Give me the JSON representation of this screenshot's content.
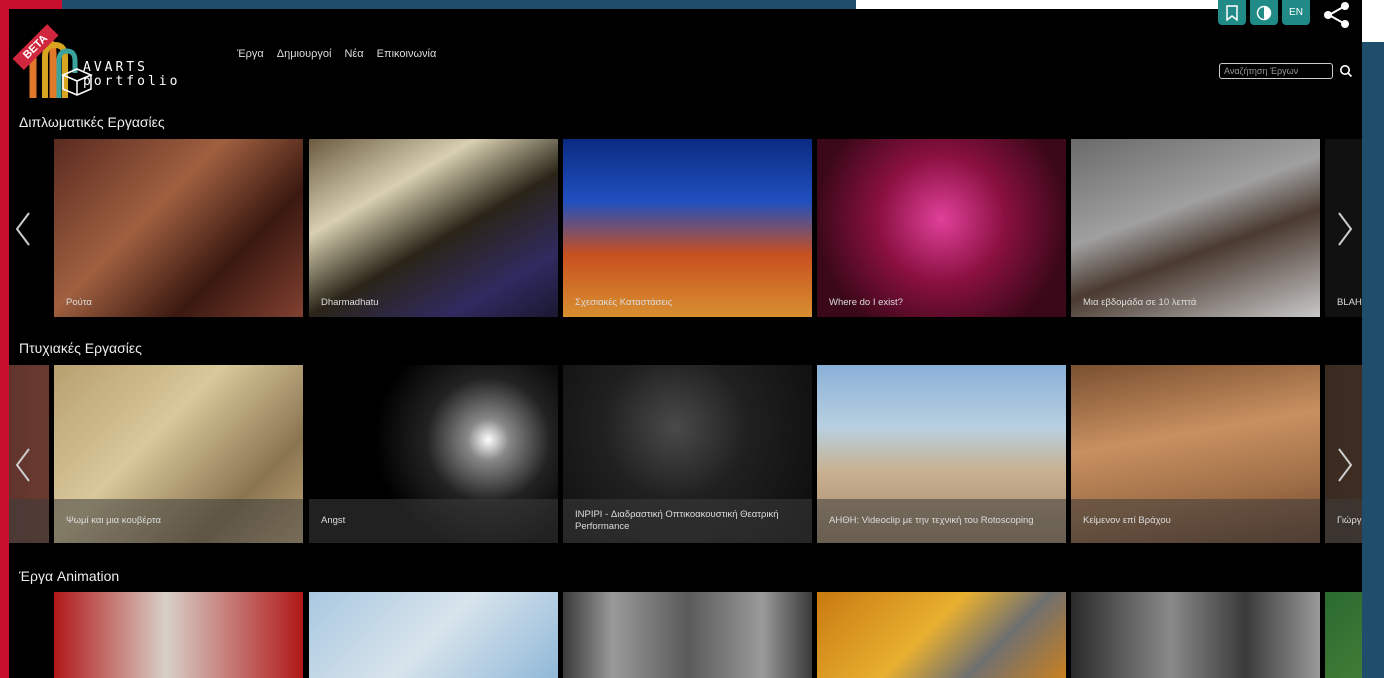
{
  "brand": {
    "beta": "BETA",
    "line1": "AVARTS",
    "line2": "portfolio"
  },
  "nav": [
    "Έργα",
    "Δημιουργοί",
    "Νέα",
    "Επικοινωνία"
  ],
  "top_buttons": {
    "lang": "EN"
  },
  "search": {
    "placeholder": "Αναζήτηση Έργων"
  },
  "sections": [
    {
      "title": "Διπλωματικές Εργασίες",
      "items": [
        "Ρούτα",
        "Dharmadhatu",
        "Σχεσιακές Καταστάσεις",
        "Where do I exist?",
        "Μια εβδομάδα σε 10 λεπτά",
        "BLAH"
      ]
    },
    {
      "title": "Πτυχιακές Εργασίες",
      "items": [
        "",
        "Ψωμί και μια κουβέρτα",
        "Angst",
        "INPIPI - Διαδραστική Οπτικοακουστική Θεατρική Performance",
        "ΑΗΘΗ: Videoclip με την τεχνική του Rotoscoping",
        "Κείμενον επί Βράχου",
        "Γιώργ επιστ"
      ]
    },
    {
      "title": "Έργα Animation",
      "items": [
        "",
        "",
        "",
        "",
        "",
        ""
      ]
    }
  ],
  "colors": {
    "accent_red": "#c8102e",
    "accent_blue": "#1e4e6b",
    "button_teal": "#1f8a86"
  }
}
